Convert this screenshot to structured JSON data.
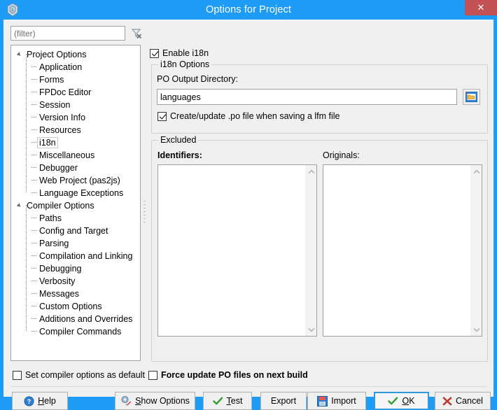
{
  "window": {
    "title": "Options for Project",
    "icon": "lazarus-app-icon",
    "close_label": "✕",
    "titlebar_color": "#1e9cf5",
    "close_button_color": "#c25154"
  },
  "filter": {
    "placeholder": "(filter)",
    "value": "",
    "clear_icon": "filter-clear-icon"
  },
  "enable_i18n": {
    "label": "Enable i18n",
    "checked": true
  },
  "tree": {
    "nodes": [
      {
        "label": "Project Options",
        "level": 0,
        "expanded": true
      },
      {
        "label": "Application",
        "level": 1
      },
      {
        "label": "Forms",
        "level": 1
      },
      {
        "label": "FPDoc Editor",
        "level": 1
      },
      {
        "label": "Session",
        "level": 1
      },
      {
        "label": "Version Info",
        "level": 1
      },
      {
        "label": "Resources",
        "level": 1
      },
      {
        "label": "i18n",
        "level": 1,
        "selected": true
      },
      {
        "label": "Miscellaneous",
        "level": 1
      },
      {
        "label": "Debugger",
        "level": 1
      },
      {
        "label": "Web Project (pas2js)",
        "level": 1
      },
      {
        "label": "Language Exceptions",
        "level": 1
      },
      {
        "label": "Compiler Options",
        "level": 0,
        "expanded": true
      },
      {
        "label": "Paths",
        "level": 1
      },
      {
        "label": "Config and Target",
        "level": 1
      },
      {
        "label": "Parsing",
        "level": 1
      },
      {
        "label": "Compilation and Linking",
        "level": 1
      },
      {
        "label": "Debugging",
        "level": 1
      },
      {
        "label": "Verbosity",
        "level": 1
      },
      {
        "label": "Messages",
        "level": 1
      },
      {
        "label": "Custom Options",
        "level": 1
      },
      {
        "label": "Additions and Overrides",
        "level": 1
      },
      {
        "label": "Compiler Commands",
        "level": 1
      }
    ]
  },
  "i18n_group": {
    "title": "i18n Options",
    "po_dir_label": "PO Output Directory:",
    "po_dir_value": "languages",
    "browse_icon": "folder-open-icon",
    "create_update_po": {
      "label": "Create/update .po file when saving a lfm file",
      "checked": true
    }
  },
  "excluded_group": {
    "title": "Excluded",
    "identifiers_label": "Identifiers:",
    "identifiers_items": [],
    "originals_label": "Originals:",
    "originals_items": []
  },
  "bottom_checkboxes": [
    {
      "label": "Set compiler options as default",
      "checked": false,
      "bold": false
    },
    {
      "label": "Force update PO files on next build",
      "checked": false,
      "bold": true
    }
  ],
  "buttons": [
    {
      "name": "help",
      "label": "Help",
      "accel": "H",
      "icon": "help-question-icon",
      "default": false
    },
    {
      "name": "show-options",
      "label": "Show Options",
      "accel": "S",
      "icon": "gear-wrench-icon",
      "default": false
    },
    {
      "name": "test",
      "label": "Test",
      "accel": "T",
      "icon": "green-check-icon",
      "default": false
    },
    {
      "name": "export",
      "label": "Export",
      "accel": "",
      "icon": "",
      "default": false
    },
    {
      "name": "import",
      "label": "Import",
      "accel": "",
      "icon": "floppy-disk-icon",
      "default": false
    },
    {
      "name": "ok",
      "label": "OK",
      "accel": "O",
      "icon": "green-check-icon",
      "default": true
    },
    {
      "name": "cancel",
      "label": "Cancel",
      "accel": "",
      "icon": "red-x-icon",
      "default": false
    }
  ]
}
